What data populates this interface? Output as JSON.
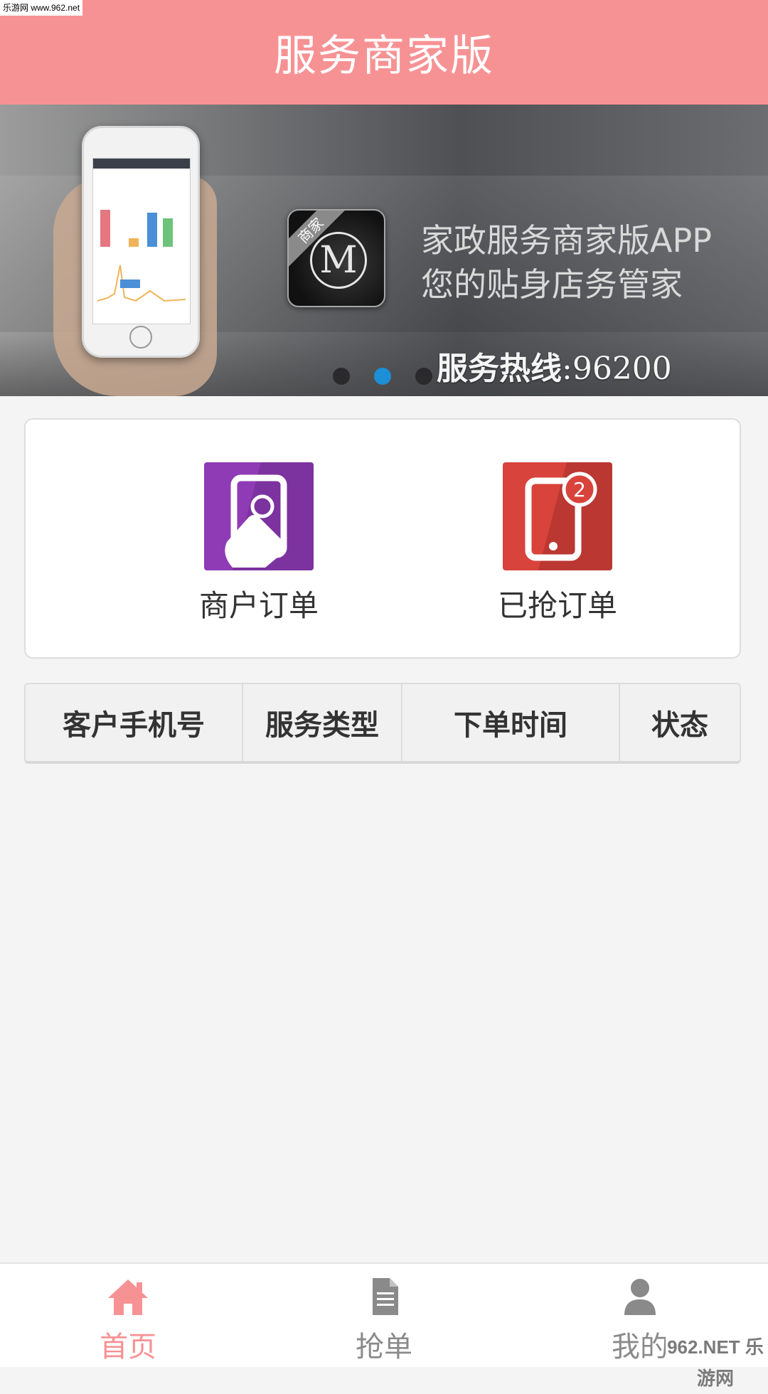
{
  "watermark_top": "乐游网 www.962.net",
  "header": {
    "title": "服务商家版"
  },
  "banner": {
    "line1": "家政服务商家版APP",
    "line2": "您的贴身店务管家",
    "hotline_label": "服务热线",
    "hotline_number": ":96200",
    "app_icon_badge": "商家",
    "app_icon_letter": "M",
    "dots": 3,
    "active_dot": 1
  },
  "entries": [
    {
      "label": "商户订单",
      "icon": "touch-tablet-icon",
      "color": "#8e3bb5"
    },
    {
      "label": "已抢订单",
      "icon": "tablet-notification-icon",
      "color": "#d8433b"
    }
  ],
  "table": {
    "columns": [
      "客户手机号",
      "服务类型",
      "下单时间",
      "状态"
    ]
  },
  "tabbar": {
    "items": [
      {
        "label": "首页",
        "icon": "home-icon",
        "active": true
      },
      {
        "label": "抢单",
        "icon": "document-icon",
        "active": false
      },
      {
        "label": "我的",
        "icon": "user-icon",
        "active": false
      }
    ]
  },
  "watermark_br": "962.NET 乐游网",
  "colors": {
    "accent": "#f79294",
    "header_text": "#ffffff",
    "active_dot": "#1d8fd6"
  }
}
